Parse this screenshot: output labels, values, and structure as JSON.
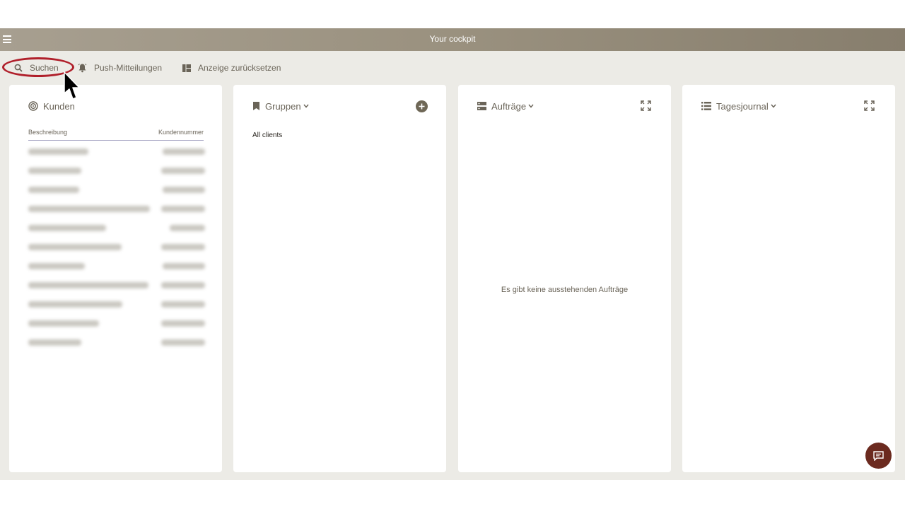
{
  "titlebar": {
    "title": "Your cockpit",
    "menu_icon": "hamburger-menu-icon"
  },
  "toolbar": {
    "search_label": "Suchen",
    "push_label": "Push-Mitteilungen",
    "reset_label": "Anzeige zurücksetzen"
  },
  "panels": {
    "kunden": {
      "title": "Kunden",
      "col_description": "Beschreibung",
      "col_number": "Kundennummer",
      "rows_blurred": 11
    },
    "gruppen": {
      "title": "Gruppen",
      "items": [
        "All clients"
      ]
    },
    "auftraege": {
      "title": "Aufträge",
      "empty_message": "Es gibt keine ausstehenden Aufträge"
    },
    "tagesjournal": {
      "title": "Tagesjournal"
    }
  },
  "colors": {
    "titlebar_start": "#a79f90",
    "titlebar_end": "#877e6d",
    "background": "#ecebe6",
    "highlight": "#b0202b",
    "chat_button": "#6b2a1f",
    "accent": "#6e6756"
  }
}
